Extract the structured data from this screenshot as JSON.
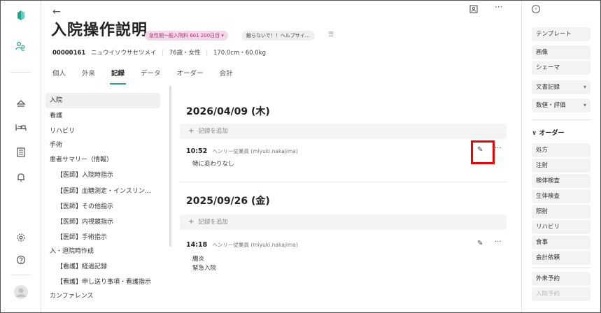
{
  "header": {
    "title": "入院操作説明",
    "badge_primary": "急性期一般入院料 601 200日目",
    "badge_secondary": "触らないで！！ヘルプサイ…",
    "patient": {
      "id": "00000161",
      "kana": "ニュウイソウサセツメイ",
      "age_sex": "76歳・女性",
      "body": "170.0cm・60.0kg"
    },
    "tabs": [
      "個人",
      "外来",
      "記録",
      "データ",
      "オーダー",
      "会計"
    ],
    "active_tab": "記録"
  },
  "record_list": [
    {
      "label": "入院",
      "indent": false,
      "active": true
    },
    {
      "label": "看護",
      "indent": false
    },
    {
      "label": "リハビリ",
      "indent": false
    },
    {
      "label": "手術",
      "indent": false
    },
    {
      "label": "患者サマリー（情報）",
      "indent": false
    },
    {
      "label": "【医師】入院時指示",
      "indent": true
    },
    {
      "label": "【医師】血糖測定・インスリン…",
      "indent": true
    },
    {
      "label": "【医師】その他指示",
      "indent": true
    },
    {
      "label": "【医師】内視鏡指示",
      "indent": true
    },
    {
      "label": "【医師】手術指示",
      "indent": true
    },
    {
      "label": "入・退院時作成",
      "indent": false
    },
    {
      "label": "【看護】経過記録",
      "indent": true
    },
    {
      "label": "【看護】申し送り事項・看護指示",
      "indent": true
    },
    {
      "label": "カンファレンス",
      "indent": false
    }
  ],
  "records": {
    "add_label": "記録を追加",
    "groups": [
      {
        "date": "2026/04/09 (木)",
        "entries": [
          {
            "time": "10:52",
            "author": "ヘンリー従業員 (miyuki.nakajima)",
            "lines": [
              "特に変わりなし"
            ]
          }
        ]
      },
      {
        "date": "2025/09/26 (金)",
        "entries": [
          {
            "time": "14:18",
            "author": "ヘンリー従業員 (miyuki.nakajima)",
            "lines": [
              "腸炎",
              "緊急入院"
            ]
          }
        ]
      }
    ]
  },
  "right_sidebar": {
    "top_buttons": [
      "テンプレート",
      "画像",
      "シェーマ"
    ],
    "dropdowns": [
      "文書記録",
      "数値・評価"
    ],
    "order_section": "オーダー",
    "order_items": [
      "処方",
      "注射",
      "検体検査",
      "生体検査",
      "照射",
      "リハビリ",
      "食事",
      "会計依頼"
    ],
    "appointment_items": [
      "外来予約",
      "入院予約"
    ]
  }
}
